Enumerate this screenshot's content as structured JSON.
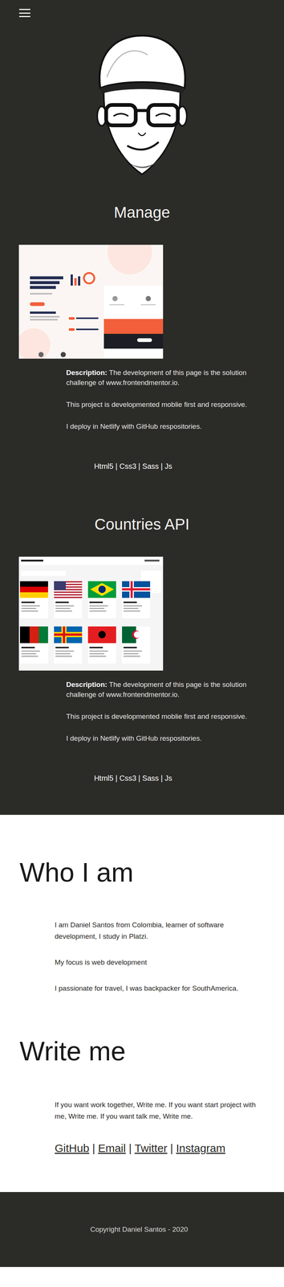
{
  "projects": [
    {
      "title": "Manage",
      "kind": "landing",
      "description_label": "Description:",
      "paragraphs": [
        "The development of this page is the solution challenge of www.frontendmentor.io.",
        "This project is developmented moblie first and responsive.",
        "I deploy in Netlify with GitHub respositories."
      ],
      "tech": "Html5 | Css3 | Sass | Js"
    },
    {
      "title": "Countries API",
      "kind": "grid",
      "description_label": "Description:",
      "paragraphs": [
        "The development of this page is the solution challenge of www.frontendmentor.io.",
        "This project is developmented moblie first and responsive.",
        "I deploy in Netlify with GitHub respositories."
      ],
      "tech": "Html5 | Css3 | Sass | Js"
    }
  ],
  "about": {
    "title": "Who I am",
    "paragraphs": [
      "I am Daniel Santos from Colombia, learner of software development, I study in Platzi.",
      "My focus is web development",
      "I passionate for travel, I was  backpacker for SouthAmerica."
    ]
  },
  "contact": {
    "title": "Write me",
    "text": "If you want work together, Write me. If you want start project with me, Write me. If you want talk me, Write me.",
    "links": [
      "GitHub",
      "Email",
      "Twitter",
      "Instagram"
    ],
    "separator": "|"
  },
  "footer": {
    "copyright": "Copyright Daniel Santos - 2020"
  }
}
